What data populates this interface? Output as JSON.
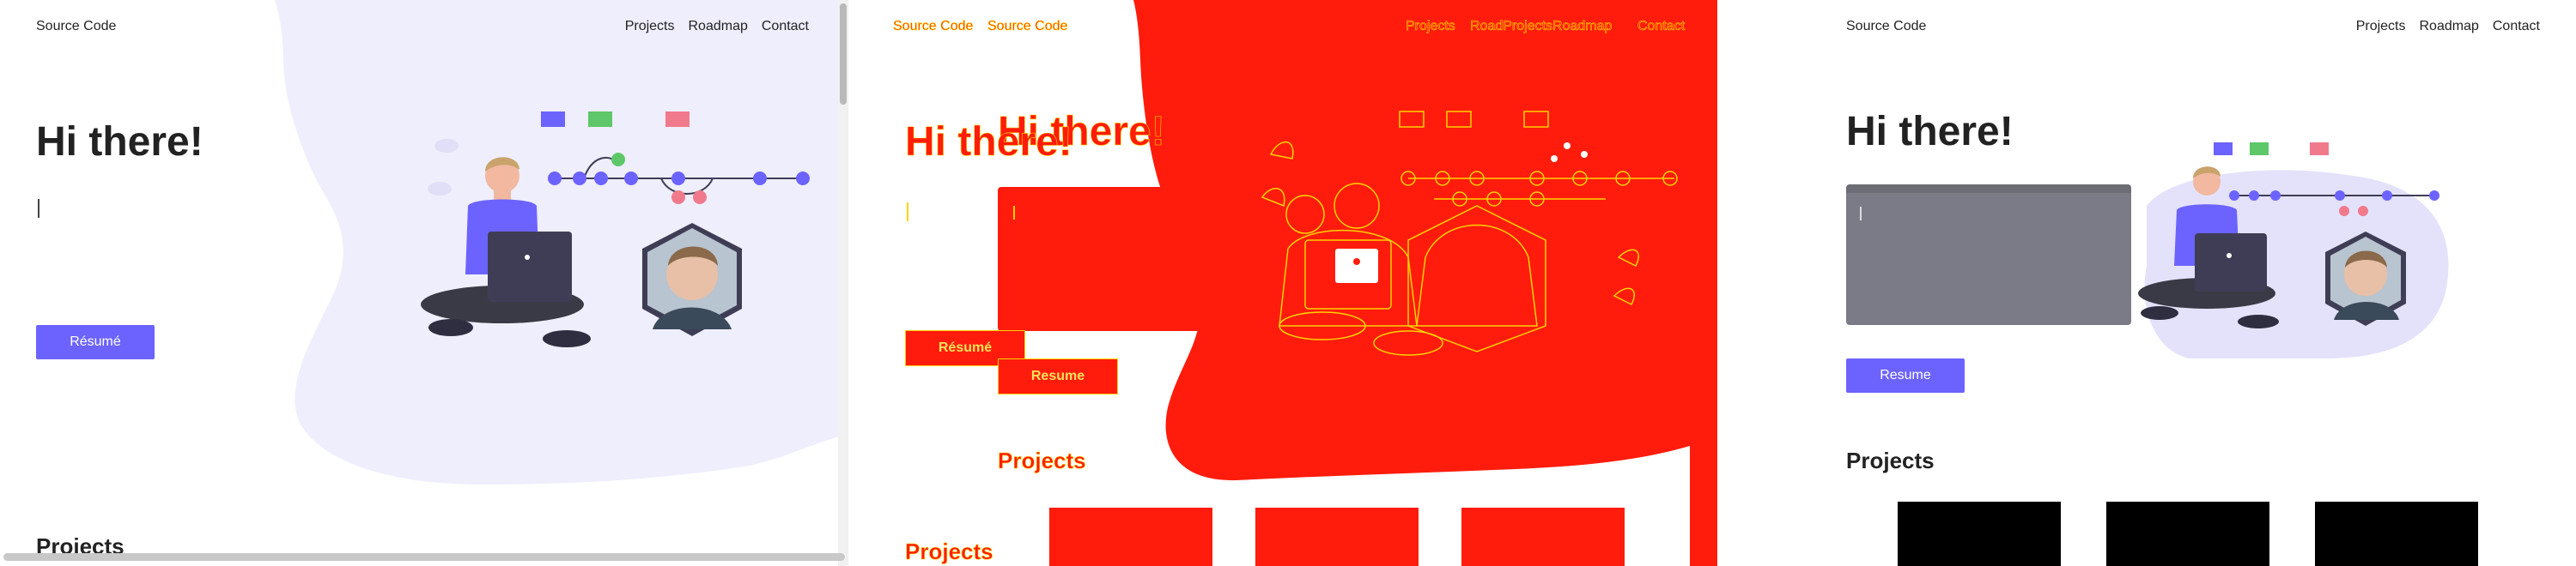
{
  "panels": [
    {
      "nav": {
        "brand": "Source Code",
        "links": [
          "Projects",
          "Roadmap",
          "Contact"
        ]
      },
      "hero": {
        "title": "Hi there!"
      },
      "resume_button": "Résumé",
      "projects_heading": "Projects"
    },
    {
      "nav": {
        "brand_a": "Source Code",
        "brand_b": "Source Code",
        "links_a": "Projects",
        "links_b": "RoadProjectsRoadmap",
        "links_c": "Contact"
      },
      "hero": {
        "title_a": "Hi there!",
        "title_b": "Hi there!"
      },
      "resume_a": "Résumé",
      "resume_b": "Resume",
      "projects_a": "Projects",
      "projects_b": "Projects"
    },
    {
      "nav": {
        "brand": "Source Code",
        "links": [
          "Projects",
          "Roadmap",
          "Contact"
        ]
      },
      "hero": {
        "title": "Hi there!"
      },
      "resume_button": "Resume",
      "projects_heading": "Projects"
    }
  ],
  "colors": {
    "accent": "#6c63ff",
    "blob": "#efeefc",
    "diff_red": "#ff1c0c",
    "diff_outline": "#ffd200",
    "editor": "#7b7b87",
    "green": "#5ec769",
    "pink": "#f07a8c"
  },
  "icons": [
    "text-cursor-icon",
    "hero-illustration",
    "laptop-icon",
    "profile-photo",
    "project-thumbnail"
  ]
}
